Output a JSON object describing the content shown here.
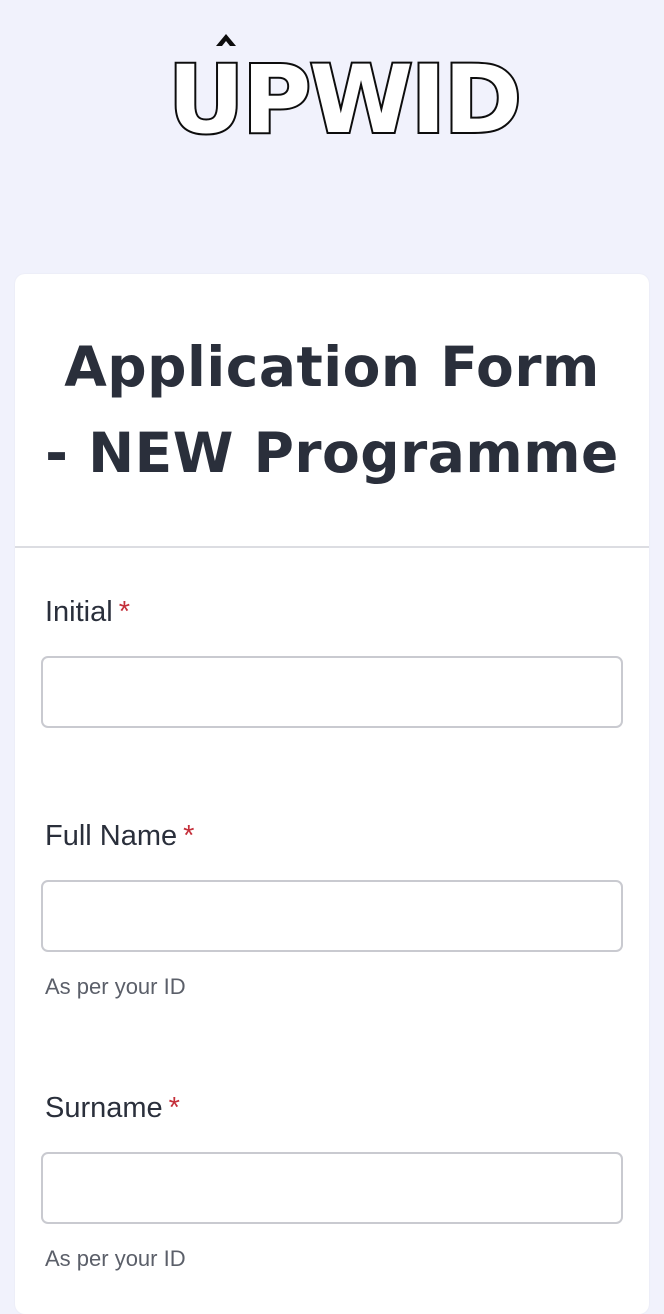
{
  "brand": {
    "logo_text": "UPWID"
  },
  "form": {
    "title": "Application Form - NEW Programme",
    "required_marker": "*",
    "fields": [
      {
        "label": "Initial",
        "value": "",
        "placeholder": "",
        "help": ""
      },
      {
        "label": "Full Name",
        "value": "",
        "placeholder": "",
        "help": "As per your ID"
      },
      {
        "label": "Surname",
        "value": "",
        "placeholder": "",
        "help": "As per your ID"
      }
    ]
  },
  "colors": {
    "page_background": "#f1f2fc",
    "card_background": "#ffffff",
    "text": "#2a2f3b",
    "required": "#c42f3a",
    "input_border": "#c9cad0",
    "help_text": "#5b5f69"
  }
}
